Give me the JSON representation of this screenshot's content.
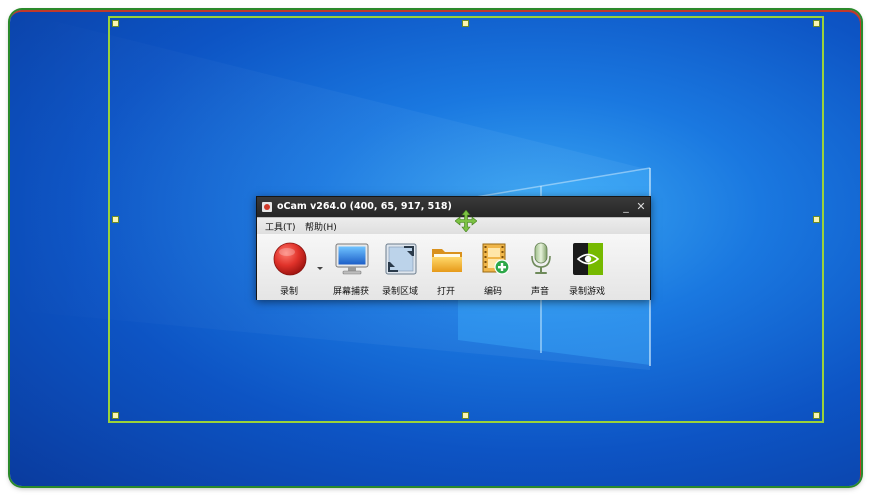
{
  "app": {
    "title": "oCam v264.0 (400, 65, 917, 518)",
    "minimize_glyph": "_",
    "close_glyph": "✕"
  },
  "menu": [
    {
      "label": "工具(T)"
    },
    {
      "label": "帮助(H)"
    }
  ],
  "toolbar": [
    {
      "label": "录制",
      "icon": "record-icon"
    },
    {
      "label": "屏幕捕获",
      "icon": "monitor-icon"
    },
    {
      "label": "录制区域",
      "icon": "resize-region-icon"
    },
    {
      "label": "打开",
      "icon": "folder-icon"
    },
    {
      "label": "编码",
      "icon": "film-plus-icon"
    },
    {
      "label": "声音",
      "icon": "microphone-icon"
    },
    {
      "label": "录制游戏",
      "icon": "nvidia-game-icon"
    }
  ],
  "colors": {
    "region_border": "#9ad23a",
    "handle_fill": "#fbf6b0",
    "desktop_blue": "#1a78e0",
    "record_red": "#e0322a"
  }
}
